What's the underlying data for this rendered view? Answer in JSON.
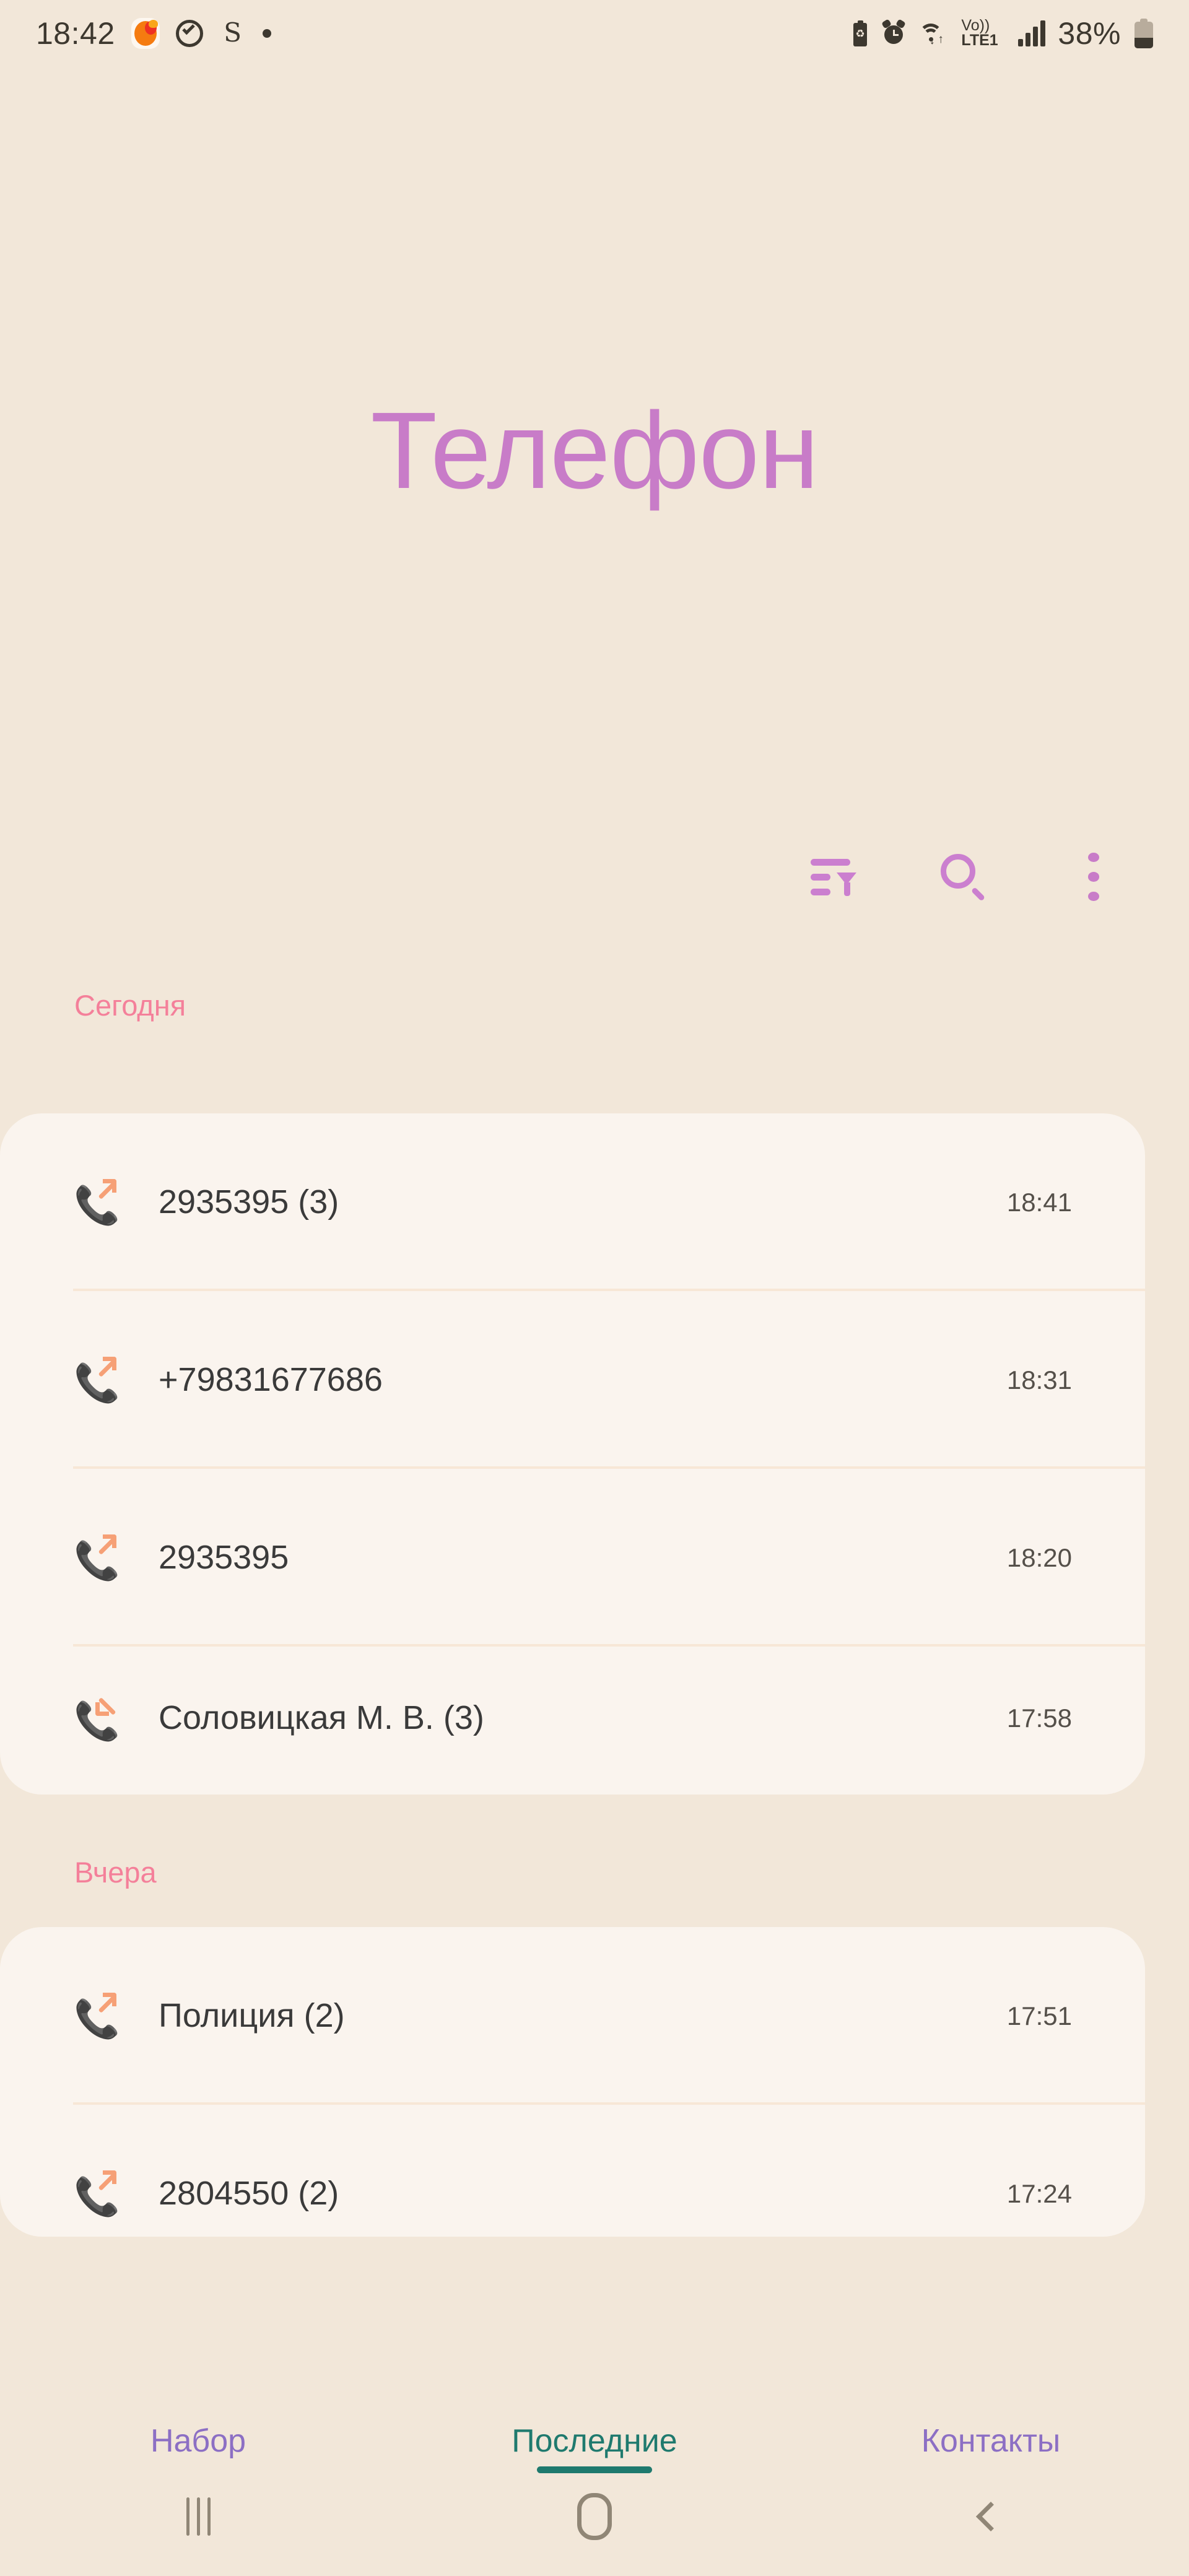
{
  "status_bar": {
    "clock": "18:42",
    "battery_percent": "38%",
    "network_label_top": "Vo))",
    "network_label_bottom": "LTE1",
    "s_glyph": "S",
    "icons": [
      "orange-blob-icon",
      "check-circle-icon",
      "s-glyph-icon",
      "dot-icon",
      "battery-saver-icon",
      "alarm-icon",
      "wifi-icon",
      "volte-icon",
      "signal-bars-icon",
      "battery-icon"
    ]
  },
  "header": {
    "title": "Телефон"
  },
  "actions": [
    {
      "name": "filter-button",
      "icon": "filter-icon"
    },
    {
      "name": "search-button",
      "icon": "search-icon"
    },
    {
      "name": "more-options-button",
      "icon": "kebab-menu-icon"
    }
  ],
  "sections": [
    {
      "label": "Сегодня",
      "calls": [
        {
          "name": "2935395 (3)",
          "time": "18:41",
          "direction": "out"
        },
        {
          "name": "+79831677686",
          "time": "18:31",
          "direction": "out"
        },
        {
          "name": "2935395",
          "time": "18:20",
          "direction": "out"
        },
        {
          "name": "Соловицкая М. В. (3)",
          "time": "17:58",
          "direction": "in"
        }
      ]
    },
    {
      "label": "Вчера",
      "calls": [
        {
          "name": "Полиция (2)",
          "time": "17:51",
          "direction": "out"
        },
        {
          "name": "2804550 (2)",
          "time": "17:24",
          "direction": "out"
        }
      ]
    }
  ],
  "tabs": [
    {
      "label": "Набор",
      "active": false
    },
    {
      "label": "Последние",
      "active": true
    },
    {
      "label": "Контакты",
      "active": false
    }
  ],
  "nav_bar": [
    {
      "name": "recents-button",
      "icon": "recents-icon"
    },
    {
      "name": "home-button",
      "icon": "home-icon"
    },
    {
      "name": "back-button",
      "icon": "back-icon"
    }
  ],
  "colors": {
    "page_background": "#f2e7d9",
    "card_background": "#faf4ee",
    "title_purple": "#c87cc8",
    "section_pink": "#f4809a",
    "call_icon_orange": "#f6a076",
    "tab_inactive_purple": "#8c6fc4",
    "tab_active_teal": "#1f7a6e",
    "divider": "#f7e7d6"
  }
}
